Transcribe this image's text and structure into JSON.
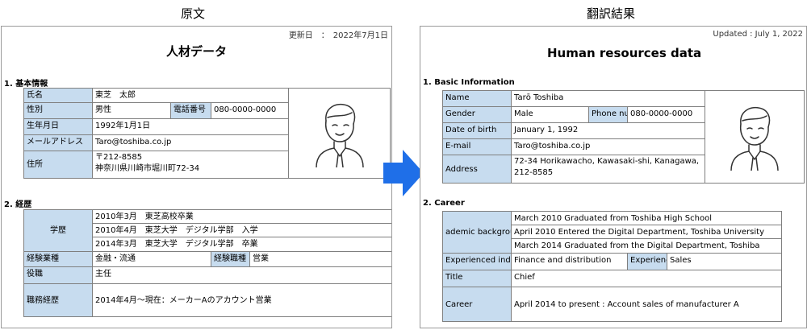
{
  "captions": {
    "original": "原文",
    "translation": "翻訳結果"
  },
  "left": {
    "updated": "更新日　：　2022年7月1日",
    "title": "人材データ",
    "section1": "1. 基本情報",
    "name_label": "氏名",
    "name_value": "東芝　太郎",
    "gender_label": "性別",
    "gender_value": "男性",
    "phone_label": "電話番号",
    "phone_value": "080-0000-0000",
    "dob_label": "生年月日",
    "dob_value": "1992年1月1日",
    "email_label": "メールアドレス",
    "email_value": "Taro@toshiba.co.jp",
    "address_label": "住所",
    "address_line1": "〒212-8585",
    "address_line2": "神奈川県川崎市堀川町72-34",
    "section2": "2. 経歴",
    "edu_label": "学歴",
    "edu_items": [
      "2010年3月　東芝高校卒業",
      "2010年4月　東芝大学　デジタル学部　入学",
      "2014年3月　東芝大学　デジタル学部　卒業"
    ],
    "industry_label": "経験業種",
    "industry_value": "金融・流通",
    "jobtype_label": "経験職種",
    "jobtype_value": "営業",
    "title_label": "役職",
    "title_value": "主任",
    "career_label": "職務経歴",
    "career_value": "2014年4月～現在：メーカーAのアカウント営業"
  },
  "right": {
    "updated": "Updated : July 1, 2022",
    "title": "Human resources data",
    "section1": "1. Basic Information",
    "name_label": "Name",
    "name_value": "Tarō Toshiba",
    "gender_label": "Gender",
    "gender_value": "Male",
    "phone_label": "Phone nu",
    "phone_value": "080-0000-0000",
    "dob_label": "Date of birth",
    "dob_value": "January 1, 1992",
    "email_label": "E-mail",
    "email_value": "Taro@toshiba.co.jp",
    "address_label": "Address",
    "address_value": "72-34 Horikawacho, Kawasaki-shi, Kanagawa, 212-8585",
    "section2": "2. Career",
    "edu_label": "ademic backgrou",
    "edu_items": [
      "March 2010 Graduated from Toshiba High School",
      "April 2010 Entered the Digital Department, Toshiba University",
      "March 2014 Graduated from the Digital Department, Toshiba"
    ],
    "industry_label": "Experienced indu",
    "industry_value": "Finance and distribution",
    "jobtype_label": "Experienc",
    "jobtype_value": "Sales",
    "title_label": "Title",
    "title_value": "Chief",
    "career_label": "Career",
    "career_value": "April 2014 to present : Account sales of manufacturer A"
  },
  "colors": {
    "label_bg": "#c7dcef",
    "arrow": "#1f6fe8"
  },
  "icons": {
    "photo": "person-avatar-icon",
    "arrow": "right-arrow-icon"
  }
}
